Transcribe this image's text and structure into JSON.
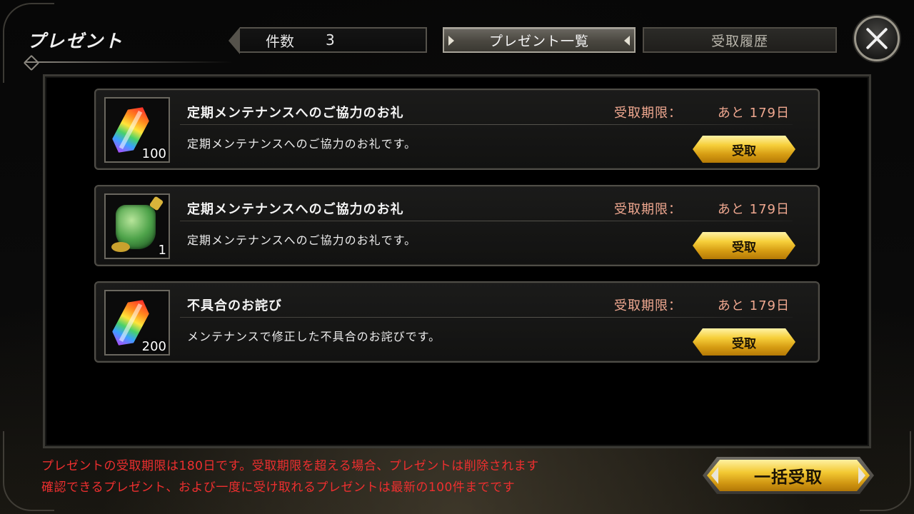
{
  "header": {
    "title": "プレゼント",
    "count_label": "件数",
    "count_value": "3",
    "tabs": [
      {
        "label": "プレゼント一覧",
        "active": true
      },
      {
        "label": "受取履歴",
        "active": false
      }
    ],
    "close_icon": "close-x-icon"
  },
  "presents": [
    {
      "title": "定期メンテナンスへのご協力のお礼",
      "description": "定期メンテナンスへのご協力のお礼です。",
      "deadline_label": "受取期限：",
      "deadline_value": "あと 179日",
      "item_icon": "rainbow-crystal-icon",
      "quantity": "100",
      "button_label": "受取"
    },
    {
      "title": "定期メンテナンスへのご協力のお礼",
      "description": "定期メンテナンスへのご協力のお礼です。",
      "deadline_label": "受取期限：",
      "deadline_value": "あと 179日",
      "item_icon": "green-potion-icon",
      "quantity": "1",
      "button_label": "受取"
    },
    {
      "title": "不具合のお詫び",
      "description": "メンテナンスで修正した不具合のお詫びです。",
      "deadline_label": "受取期限：",
      "deadline_value": "あと 179日",
      "item_icon": "rainbow-crystal-icon",
      "quantity": "200",
      "button_label": "受取"
    }
  ],
  "footer": {
    "notice_line1": "プレゼントの受取期限は180日です。受取期限を超える場合、プレゼントは削除されます",
    "notice_line2": "確認できるプレゼント、および一度に受け取れるプレゼントは最新の100件までです",
    "bulk_button_label": "一括受取"
  },
  "colors": {
    "deadline_text": "#f0a890",
    "notice_text": "#ee2f2f",
    "gold_button": "#f3c933"
  }
}
